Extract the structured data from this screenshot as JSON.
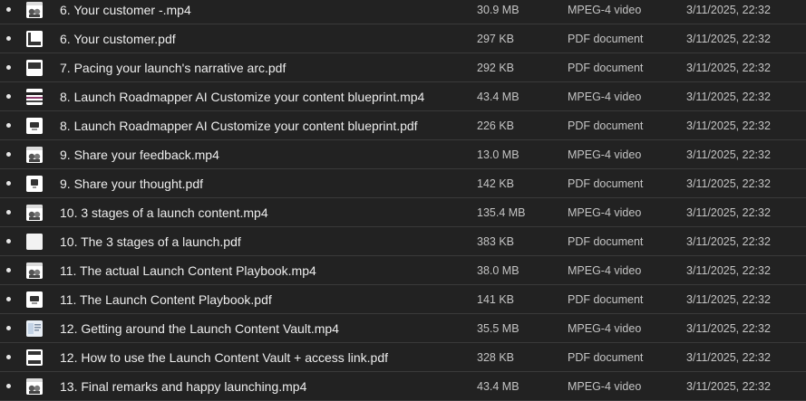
{
  "files": [
    {
      "name": "6. Your customer -.mp4",
      "size": "30.9 MB",
      "type": "MPEG-4 video",
      "date": "3/11/2025, 22:32",
      "icon": "video-thumbnail-icon"
    },
    {
      "name": "6. Your customer.pdf",
      "size": "297 KB",
      "type": "PDF document",
      "date": "3/11/2025, 22:32",
      "icon": "pdf-thumbnail-icon"
    },
    {
      "name": "7. Pacing your launch's narrative arc.pdf",
      "size": "292 KB",
      "type": "PDF document",
      "date": "3/11/2025, 22:32",
      "icon": "pdf-thumbnail-icon"
    },
    {
      "name": "8. Launch Roadmapper AI Customize your content blueprint.mp4",
      "size": "43.4 MB",
      "type": "MPEG-4 video",
      "date": "3/11/2025, 22:32",
      "icon": "video-thumbnail-icon"
    },
    {
      "name": "8. Launch Roadmapper AI Customize your content blueprint.pdf",
      "size": "226 KB",
      "type": "PDF document",
      "date": "3/11/2025, 22:32",
      "icon": "pdf-thumbnail-icon"
    },
    {
      "name": "9. Share your feedback.mp4",
      "size": "13.0 MB",
      "type": "MPEG-4 video",
      "date": "3/11/2025, 22:32",
      "icon": "video-thumbnail-icon"
    },
    {
      "name": "9. Share your thought.pdf",
      "size": "142 KB",
      "type": "PDF document",
      "date": "3/11/2025, 22:32",
      "icon": "pdf-thumbnail-icon"
    },
    {
      "name": "10. 3 stages of a launch content.mp4",
      "size": "135.4 MB",
      "type": "MPEG-4 video",
      "date": "3/11/2025, 22:32",
      "icon": "video-thumbnail-icon"
    },
    {
      "name": "10. The 3 stages of a launch.pdf",
      "size": "383 KB",
      "type": "PDF document",
      "date": "3/11/2025, 22:32",
      "icon": "pdf-thumbnail-icon"
    },
    {
      "name": "11. The actual Launch Content Playbook.mp4",
      "size": "38.0 MB",
      "type": "MPEG-4 video",
      "date": "3/11/2025, 22:32",
      "icon": "video-thumbnail-icon"
    },
    {
      "name": "11. The Launch Content Playbook.pdf",
      "size": "141 KB",
      "type": "PDF document",
      "date": "3/11/2025, 22:32",
      "icon": "pdf-thumbnail-icon"
    },
    {
      "name": "12. Getting around the Launch Content Vault.mp4",
      "size": "35.5 MB",
      "type": "MPEG-4 video",
      "date": "3/11/2025, 22:32",
      "icon": "video-thumbnail-icon"
    },
    {
      "name": "12. How to use the Launch Content Vault + access link.pdf",
      "size": "328 KB",
      "type": "PDF document",
      "date": "3/11/2025, 22:32",
      "icon": "pdf-thumbnail-icon"
    },
    {
      "name": "13. Final remarks and happy launching.mp4",
      "size": "43.4 MB",
      "type": "MPEG-4 video",
      "date": "3/11/2025, 22:32",
      "icon": "video-thumbnail-icon"
    }
  ],
  "colors": {
    "background": "#222222",
    "divider": "#3a3a3a",
    "text": "#ededed",
    "muted": "#c4c4c4"
  }
}
